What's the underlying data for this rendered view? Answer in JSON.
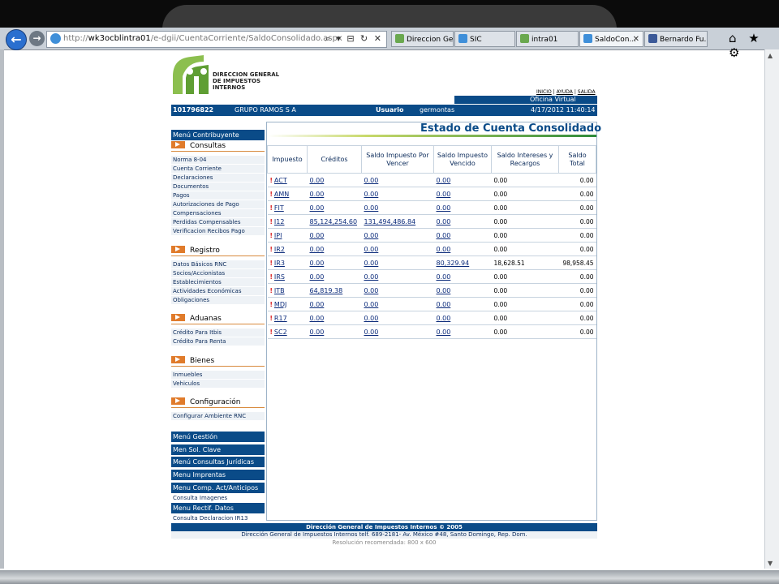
{
  "browser": {
    "url_prefix": "http://",
    "url_host": "wk3ocblintra01",
    "url_path": "/e-dgii/CuentaCorriente/SaldoConsolidado.aspx",
    "address_icons": "⌕ ▾ ⊟ ↻ ✕",
    "tabs": [
      {
        "label": "Direccion Ge...",
        "color": "#6aa84f",
        "active": false
      },
      {
        "label": "SIC",
        "color": "#3f8fd9",
        "active": false
      },
      {
        "label": "intra01",
        "color": "#6aa84f",
        "active": false
      },
      {
        "label": "SaldoCon...",
        "color": "#3f8fd9",
        "active": true
      },
      {
        "label": "Bernardo Fu...",
        "color": "#3b5998",
        "active": false
      }
    ],
    "tab_close": "✕",
    "right_icons": "⌂ ★ ⚙"
  },
  "header": {
    "logo_text": [
      "DIRECCION GENERAL",
      "DE IMPUESTOS",
      "INTERNOS"
    ],
    "links": [
      "INICIO",
      "AYUDA",
      "SALIDA"
    ],
    "link_sep": "|",
    "virtual_label": "Oficina Virtual",
    "rnc": "101796822",
    "company": "GRUPO RAMOS S A",
    "usuario_label": "Usuario",
    "usuario": "germontas",
    "datetime": "4/17/2012 11:40:14 AM"
  },
  "menu": {
    "contribuyente": "Menú Contribuyente",
    "consultas": {
      "title": "Consultas",
      "items": [
        "Norma 8-04",
        "Cuenta Corriente",
        "Declaraciones",
        "Documentos",
        "Pagos",
        "Autorizaciones de Pago",
        "Compensaciones",
        "Perdidas Compensables",
        "Verificacion Recibos Pago"
      ]
    },
    "registro": {
      "title": "Registro",
      "items": [
        "Datos Básicos RNC",
        "Socios/Accionistas",
        "Establecimientos",
        "Actividades Económicas",
        "Obligaciones"
      ]
    },
    "aduanas": {
      "title": "Aduanas",
      "items": [
        "Crédito Para Itbis",
        "Crédito Para Renta"
      ]
    },
    "bienes": {
      "title": "Bienes",
      "items": [
        "Inmuebles",
        "Vehiculos"
      ]
    },
    "configuracion": {
      "title": "Configuración",
      "items": [
        "Configurar Ambiente RNC"
      ]
    },
    "gestion": "Menú Gestión",
    "sol_clave": "Men Sol. Clave",
    "juridicas": "Menú Consultas Jurídicas",
    "imprentas": "Menu Imprentas",
    "comp": "Menu Comp. Act/Anticipos",
    "consulta_imagenes": "Consulta Imagenes",
    "rectif": "Menu Rectif. Datos",
    "consulta_ir13": "Consulta Declaracion IR13"
  },
  "content": {
    "title": "Estado de Cuenta Consolidado",
    "columns": [
      "Impuesto",
      "Créditos",
      "Saldo Impuesto Por Vencer",
      "Saldo Impuesto Vencido",
      "Saldo Intereses y Recargos",
      "Saldo Total"
    ],
    "alert_mark": "!",
    "rows": [
      {
        "impuesto": "ACT",
        "creditos": "0.00",
        "por_vencer": "0.00",
        "vencido": "0.00",
        "intereses": "0.00",
        "total": "0.00"
      },
      {
        "impuesto": "AMN",
        "creditos": "0.00",
        "por_vencer": "0.00",
        "vencido": "0.00",
        "intereses": "0.00",
        "total": "0.00"
      },
      {
        "impuesto": "FIT",
        "creditos": "0.00",
        "por_vencer": "0.00",
        "vencido": "0.00",
        "intereses": "0.00",
        "total": "0.00"
      },
      {
        "impuesto": "I12",
        "creditos": "85,124,254.60",
        "por_vencer": "131,494,486.84",
        "vencido": "0.00",
        "intereses": "0.00",
        "total": "0.00"
      },
      {
        "impuesto": "IPI",
        "creditos": "0.00",
        "por_vencer": "0.00",
        "vencido": "0.00",
        "intereses": "0.00",
        "total": "0.00"
      },
      {
        "impuesto": "IR2",
        "creditos": "0.00",
        "por_vencer": "0.00",
        "vencido": "0.00",
        "intereses": "0.00",
        "total": "0.00"
      },
      {
        "impuesto": "IR3",
        "creditos": "0.00",
        "por_vencer": "0.00",
        "vencido": "80,329.94",
        "intereses": "18,628.51",
        "total": "98,958.45"
      },
      {
        "impuesto": "IRS",
        "creditos": "0.00",
        "por_vencer": "0.00",
        "vencido": "0.00",
        "intereses": "0.00",
        "total": "0.00"
      },
      {
        "impuesto": "ITB",
        "creditos": "64,819.38",
        "por_vencer": "0.00",
        "vencido": "0.00",
        "intereses": "0.00",
        "total": "0.00"
      },
      {
        "impuesto": "MDJ",
        "creditos": "0.00",
        "por_vencer": "0.00",
        "vencido": "0.00",
        "intereses": "0.00",
        "total": "0.00"
      },
      {
        "impuesto": "R17",
        "creditos": "0.00",
        "por_vencer": "0.00",
        "vencido": "0.00",
        "intereses": "0.00",
        "total": "0.00"
      },
      {
        "impuesto": "SC2",
        "creditos": "0.00",
        "por_vencer": "0.00",
        "vencido": "0.00",
        "intereses": "0.00",
        "total": "0.00"
      }
    ]
  },
  "footer": {
    "line1": "Dirección General de Impuestos Internos © 2005",
    "line2": "Dirección General de Impuestos Internos telf. 689-2181- Av. México #48, Santo Domingo, Rep. Dom.",
    "line3": "Resolución recomendada: 800 x 600"
  },
  "colors": {
    "brand_blue": "#0a4b88",
    "accent_orange": "#e07b2b",
    "logo_green": "#6aa84f",
    "alert_red": "#d81b1b"
  }
}
